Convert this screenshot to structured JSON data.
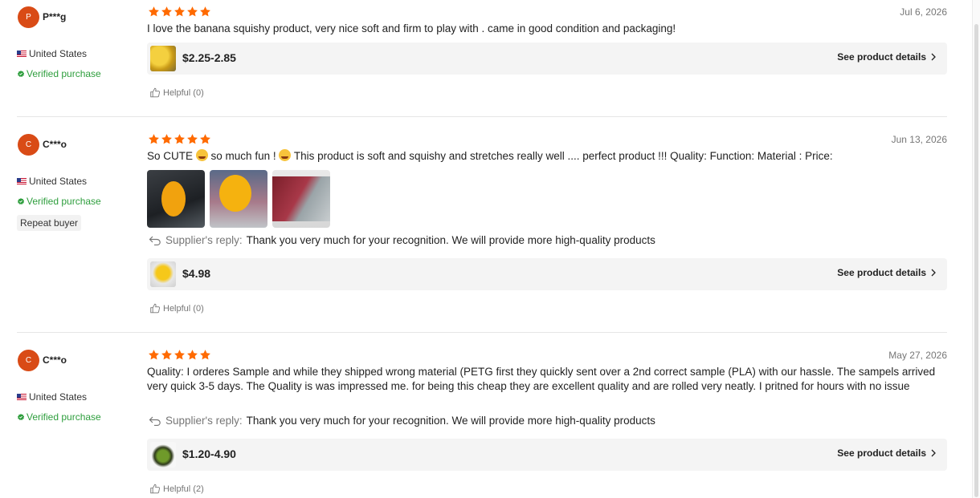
{
  "colors": {
    "star": "#ff6a00",
    "verified": "#2e9e3d",
    "avatar": "#d94b16",
    "date": "#767676"
  },
  "reviews": [
    {
      "avatar_letter": "P",
      "username": "P***g",
      "country": "United States",
      "verified": "Verified purchase",
      "badge": "",
      "rating": 5,
      "date": "Jul 6, 2026",
      "text": "I love the banana squishy product, very nice soft and firm to play with . came in good condition and packaging!",
      "reply_label": "",
      "reply_text": "",
      "price": "$2.25-2.85",
      "details_label": "See product details",
      "helpful": "Helpful (0)"
    },
    {
      "avatar_letter": "C",
      "username": "C***o",
      "country": "United States",
      "verified": "Verified purchase",
      "badge": "Repeat buyer",
      "rating": 5,
      "date": "Jun 13, 2026",
      "text_part1": "So CUTE",
      "text_part2": "so much fun !",
      "text_part3": "This product is soft and squishy and stretches really well .... perfect product !!! Quality: Function: Material : Price:",
      "photos": [
        "photo-1",
        "photo-2",
        "photo-3"
      ],
      "reply_label": "Supplier's reply:",
      "reply_text": "Thank you very much for your recognition. We will provide more high-quality products",
      "price": "$4.98",
      "details_label": "See product details",
      "helpful": "Helpful (0)"
    },
    {
      "avatar_letter": "C",
      "username": "C***o",
      "country": "United States",
      "verified": "Verified purchase",
      "badge": "",
      "rating": 5,
      "date": "May 27, 2026",
      "text": "Quality: I orderes Sample and while they shipped wrong material (PETG first they quickly sent over a 2nd correct sample (PLA) with our hassle. The sampels arrived very quick 3-5 days.  The Quality is was impressed me. for being this cheap they are excellent quality and are rolled very neatly. I pritned for hours with no issue",
      "reply_label": "Supplier's reply:",
      "reply_text": "Thank you very much for your recognition. We will provide more high-quality products",
      "price": "$1.20-4.90",
      "details_label": "See product details",
      "helpful": "Helpful (2)"
    }
  ]
}
